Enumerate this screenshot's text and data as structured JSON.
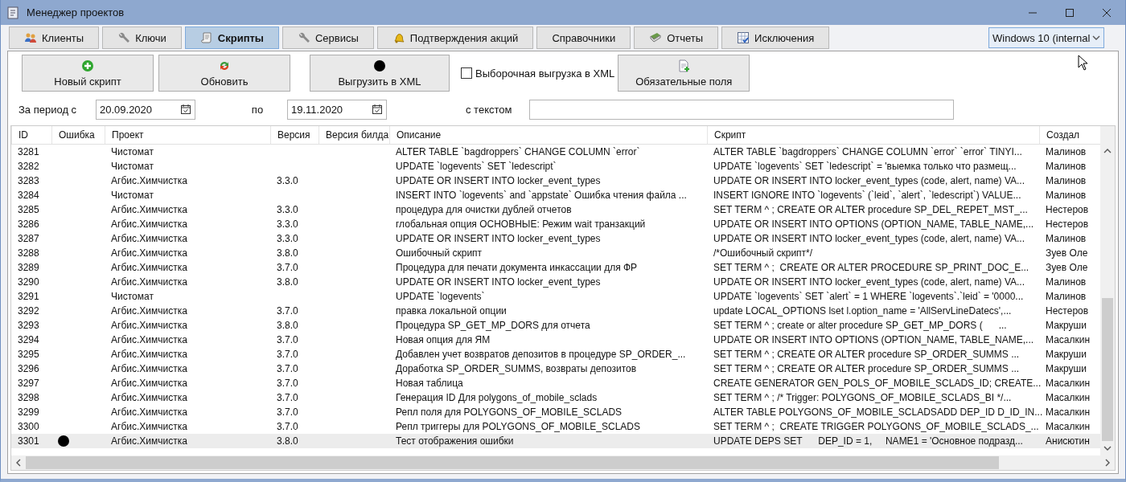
{
  "window": {
    "title": "Менеджер проектов"
  },
  "tabs": [
    {
      "label": "Клиенты",
      "selected": false
    },
    {
      "label": "Ключи",
      "selected": false
    },
    {
      "label": "Скрипты",
      "selected": true
    },
    {
      "label": "Сервисы",
      "selected": false
    },
    {
      "label": "Подтверждения акций",
      "selected": false
    },
    {
      "label": "Справочники",
      "selected": false
    },
    {
      "label": "Отчеты",
      "selected": false
    },
    {
      "label": "Исключения",
      "selected": false
    }
  ],
  "environment_dropdown": {
    "value": "Windows 10 (internal"
  },
  "toolbar": {
    "new_script": "Новый скрипт",
    "refresh": "Обновить",
    "export_xml": "Выгрузить в XML",
    "selective_export": {
      "label": "Выборочная выгрузка в XML",
      "checked": false
    },
    "required_fields": "Обязательные поля"
  },
  "filters": {
    "period_from_label": "За период с",
    "period_from": "20.09.2020",
    "period_to_label": "по",
    "period_to": "19.11.2020",
    "text_label": "с текстом"
  },
  "table": {
    "columns": [
      "ID",
      "Ошибка",
      "Проект",
      "Версия",
      "Версия билда",
      "Описание",
      "Скрипт",
      "Создал"
    ],
    "rows": [
      {
        "id": "3281",
        "error": false,
        "project": "Чистомат",
        "version": "",
        "description": "ALTER TABLE `bagdroppers` CHANGE COLUMN `error`",
        "script": "ALTER TABLE `bagdroppers` CHANGE COLUMN `error` `error` TINYI...",
        "author": "Малинов",
        "selected": false
      },
      {
        "id": "3282",
        "error": false,
        "project": "Чистомат",
        "version": "",
        "description": "UPDATE `logevents` SET `ledescript`",
        "script": "UPDATE `logevents` SET `ledescript` = 'выемка только что размещ...",
        "author": "Малинов",
        "selected": false
      },
      {
        "id": "3283",
        "error": false,
        "project": "Агбис.Химчистка",
        "version": "3.3.0",
        "description": "UPDATE OR INSERT INTO locker_event_types",
        "script": "UPDATE OR INSERT INTO locker_event_types (code, alert, name) VA...",
        "author": "Малинов",
        "selected": false
      },
      {
        "id": "3284",
        "error": false,
        "project": "Чистомат",
        "version": "",
        "description": "INSERT INTO `logevents` and `appstate` Ошибка чтения файла ...",
        "script": "INSERT IGNORE INTO `logevents` (`leid`, `alert`, `ledescript`) VALUE...",
        "author": "Малинов",
        "selected": false
      },
      {
        "id": "3285",
        "error": false,
        "project": "Агбис.Химчистка",
        "version": "3.3.0",
        "description": "процедура для очистки дублей отчетов",
        "script": "SET TERM ^ ; CREATE OR ALTER procedure SP_DEL_REPET_MST_...",
        "author": "Нестеров",
        "selected": false
      },
      {
        "id": "3286",
        "error": false,
        "project": "Агбис.Химчистка",
        "version": "3.3.0",
        "description": "глобальная опция ОСНОВНЫЕ: Режим wait транзакций",
        "script": "UPDATE OR INSERT INTO OPTIONS (OPTION_NAME, TABLE_NAME,...",
        "author": "Нестеров",
        "selected": false
      },
      {
        "id": "3287",
        "error": false,
        "project": "Агбис.Химчистка",
        "version": "3.3.0",
        "description": "UPDATE OR INSERT INTO locker_event_types",
        "script": "UPDATE OR INSERT INTO locker_event_types (code, alert, name) VA...",
        "author": "Малинов",
        "selected": false
      },
      {
        "id": "3288",
        "error": false,
        "project": "Агбис.Химчистка",
        "version": "3.8.0",
        "description": "Ошибочный скрипт",
        "script": "/*Ошибочный скрипт*/",
        "author": "Зуев Оле",
        "selected": false
      },
      {
        "id": "3289",
        "error": false,
        "project": "Агбис.Химчистка",
        "version": "3.7.0",
        "description": "Процедура для печати документа инкассации для ФР",
        "script": "SET TERM ^ ;  CREATE OR ALTER PROCEDURE SP_PRINT_DOC_E...",
        "author": "Зуев Оле",
        "selected": false
      },
      {
        "id": "3290",
        "error": false,
        "project": "Агбис.Химчистка",
        "version": "3.8.0",
        "description": "UPDATE OR INSERT INTO locker_event_types",
        "script": "UPDATE OR INSERT INTO locker_event_types (code, alert, name) VA...",
        "author": "Малинов",
        "selected": false
      },
      {
        "id": "3291",
        "error": false,
        "project": "Чистомат",
        "version": "",
        "description": "UPDATE `logevents`",
        "script": "UPDATE `logevents` SET `alert` = 1 WHERE `logevents`.`leid` = '0000...",
        "author": "Малинов",
        "selected": false
      },
      {
        "id": "3292",
        "error": false,
        "project": "Агбис.Химчистка",
        "version": "3.7.0",
        "description": "правка локальной опции",
        "script": "update LOCAL_OPTIONS lset l.option_name = 'AllServLineDatecs',...",
        "author": "Нестеров",
        "selected": false
      },
      {
        "id": "3293",
        "error": false,
        "project": "Агбис.Химчистка",
        "version": "3.8.0",
        "description": "Процедура SP_GET_MP_DORS для отчета",
        "script": "SET TERM ^ ; create or alter procedure SP_GET_MP_DORS (      ...",
        "author": "Макруши",
        "selected": false
      },
      {
        "id": "3294",
        "error": false,
        "project": "Агбис.Химчистка",
        "version": "3.7.0",
        "description": "Новая опция для ЯМ",
        "script": "UPDATE OR INSERT INTO OPTIONS (OPTION_NAME, TABLE_NAME,...",
        "author": "Масалкин",
        "selected": false
      },
      {
        "id": "3295",
        "error": false,
        "project": "Агбис.Химчистка",
        "version": "3.7.0",
        "description": "Добавлен учет возвратов депозитов в процедуре SP_ORDER_...",
        "script": "SET TERM ^ ; CREATE OR ALTER procedure SP_ORDER_SUMMS ...",
        "author": "Макруши",
        "selected": false
      },
      {
        "id": "3296",
        "error": false,
        "project": "Агбис.Химчистка",
        "version": "3.7.0",
        "description": "Доработка SP_ORDER_SUMMS, возвраты депозитов",
        "script": "SET TERM ^ ; CREATE OR ALTER procedure SP_ORDER_SUMMS ...",
        "author": "Макруши",
        "selected": false
      },
      {
        "id": "3297",
        "error": false,
        "project": "Агбис.Химчистка",
        "version": "3.7.0",
        "description": "Новая таблица",
        "script": "CREATE GENERATOR GEN_POLS_OF_MOBILE_SCLADS_ID; CREATE...",
        "author": "Масалкин",
        "selected": false
      },
      {
        "id": "3298",
        "error": false,
        "project": "Агбис.Химчистка",
        "version": "3.7.0",
        "description": "Генерация ID Для polygons_of_mobile_sclads",
        "script": "SET TERM ^ ; /* Trigger: POLYGONS_OF_MOBILE_SCLADS_BI */...",
        "author": "Масалкин",
        "selected": false
      },
      {
        "id": "3299",
        "error": false,
        "project": "Агбис.Химчистка",
        "version": "3.7.0",
        "description": "Репл поля для POLYGONS_OF_MOBILE_SCLADS",
        "script": "ALTER TABLE POLYGONS_OF_MOBILE_SCLADSADD DEP_ID D_ID_IN...",
        "author": "Масалкин",
        "selected": false
      },
      {
        "id": "3300",
        "error": false,
        "project": "Агбис.Химчистка",
        "version": "3.7.0",
        "description": "Репл триггеры для POLYGONS_OF_MOBILE_SCLADS",
        "script": "SET TERM ^ ;  CREATE TRIGGER POLYGONS_OF_MOBILE_SCLADS_...",
        "author": "Масалкин",
        "selected": false
      },
      {
        "id": "3301",
        "error": true,
        "project": "Агбис.Химчистка",
        "version": "3.8.0",
        "description": "Тест отображения ошибки",
        "script": "UPDATE DEPS SET      DEP_ID = 1,     NAME1 = 'Основное подразд...",
        "author": "Анисютин",
        "selected": true
      }
    ]
  }
}
